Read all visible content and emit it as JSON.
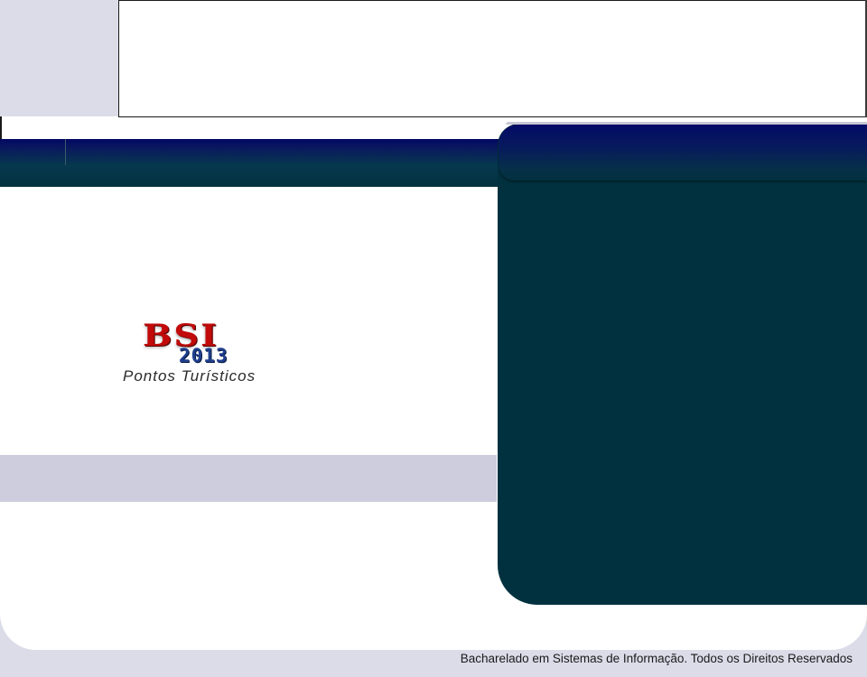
{
  "logo": {
    "title": "BSI",
    "year": "2013",
    "subtitle": "Pontos Turísticos"
  },
  "footer": {
    "copyright": "Bacharelado em Sistemas de Informação. Todos os Direitos Reservados"
  },
  "colors": {
    "background": "#dcdce9",
    "nav_gradient_top": "#020863",
    "nav_gradient_bottom": "#023140",
    "right_panel": "#01313f",
    "gray_band": "#cdcddd",
    "logo_red": "#c20a0a",
    "logo_blue": "#1f3f8e"
  }
}
